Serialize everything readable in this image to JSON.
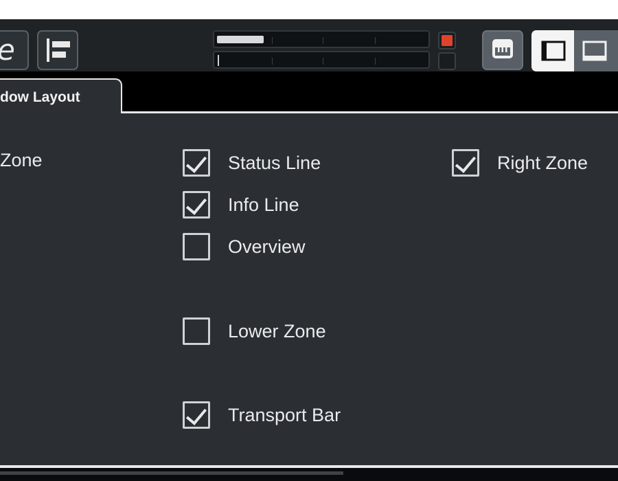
{
  "tab": {
    "label": "dow Layout"
  },
  "options": {
    "left_zone": {
      "label": "Zone",
      "checked": true
    },
    "status_line": {
      "label": "Status Line",
      "checked": true
    },
    "info_line": {
      "label": "Info Line",
      "checked": true
    },
    "overview": {
      "label": "Overview",
      "checked": false
    },
    "lower_zone": {
      "label": "Lower Zone",
      "checked": false
    },
    "transport_bar": {
      "label": "Transport Bar",
      "checked": true
    },
    "right_zone": {
      "label": "Right Zone",
      "checked": true
    }
  },
  "toolbar": {
    "icons": [
      "e-logo-icon",
      "align-left-icon",
      "midi-keyboard-icon",
      "left-zone-icon",
      "lower-zone-icon"
    ]
  },
  "colors": {
    "background": "#2b2f33",
    "clip_indicator": "#e0432c",
    "accent_active": "#f4f4f4"
  }
}
